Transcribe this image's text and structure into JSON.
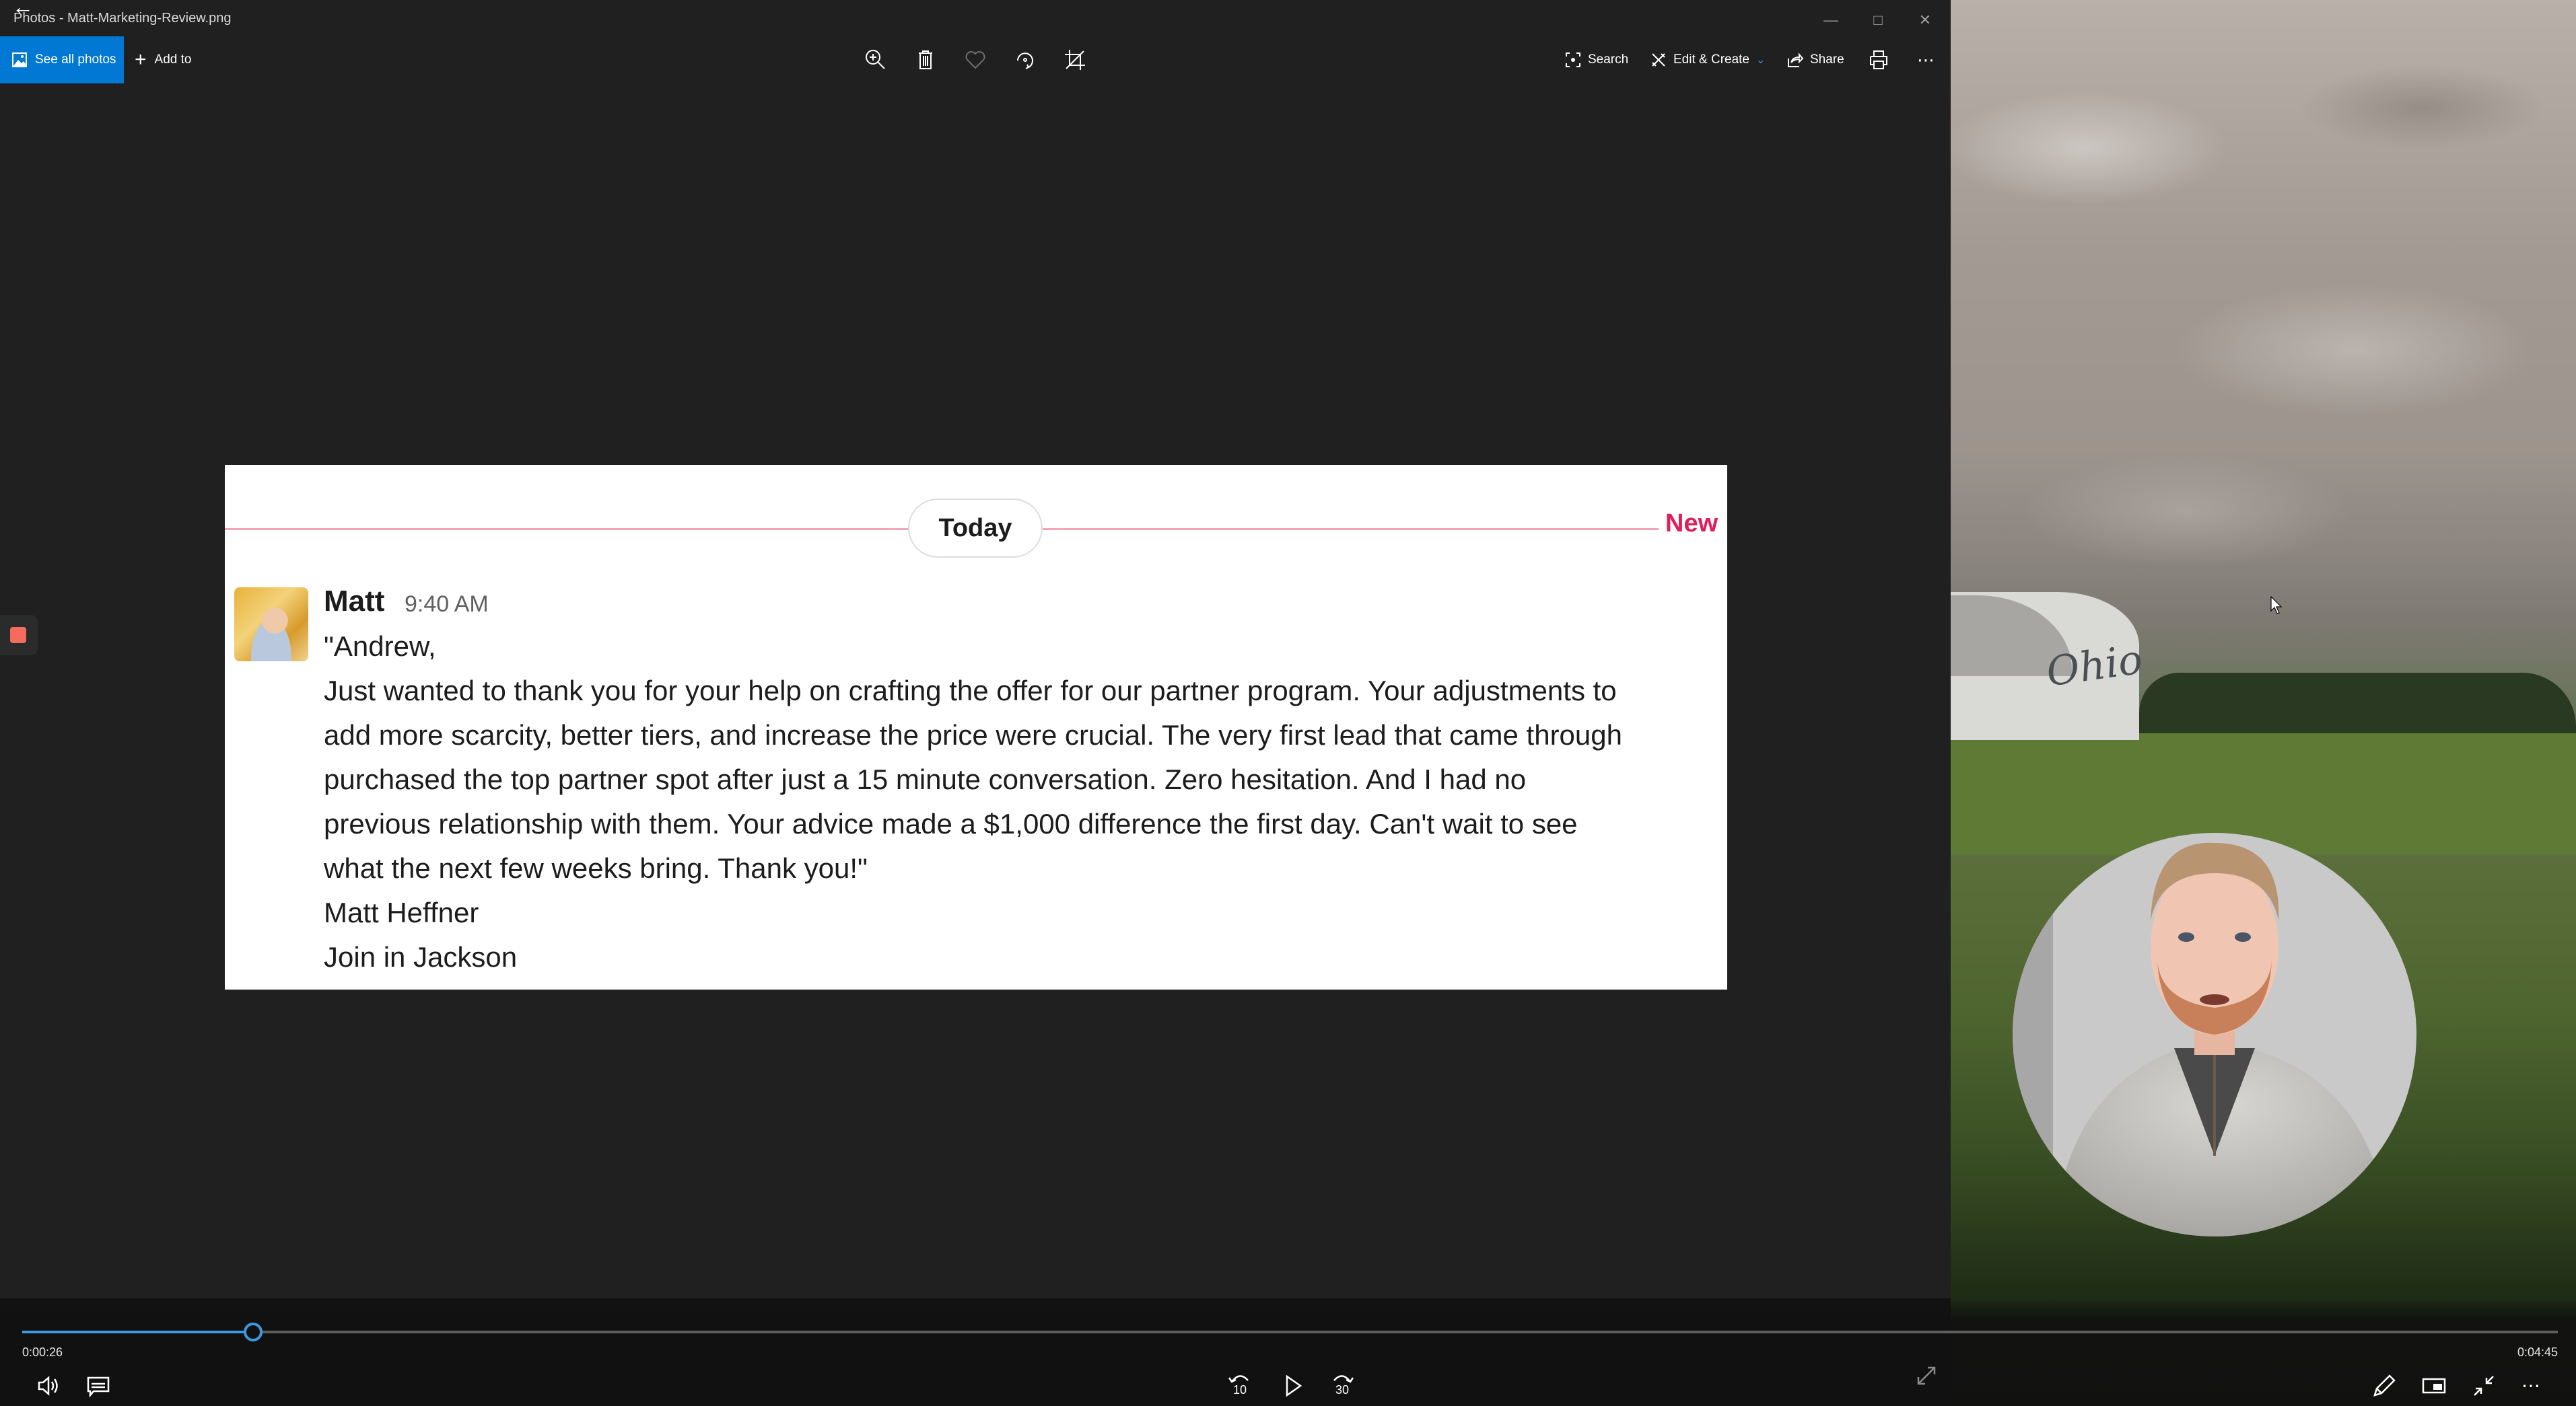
{
  "window": {
    "title": "Photos - Matt-Marketing-Review.png",
    "back_icon": "back-arrow-icon",
    "controls": [
      "minimize",
      "maximize",
      "close"
    ]
  },
  "toolbar": {
    "see_all_photos": "See all photos",
    "add_to": "Add to",
    "center_icons": [
      "zoom-in-icon",
      "delete-icon",
      "favorite-icon",
      "rotate-icon",
      "crop-icon"
    ],
    "search": "Search",
    "edit_create": "Edit & Create",
    "share": "Share",
    "print_icon": "print-icon",
    "more_icon": "more-icon"
  },
  "message": {
    "divider_label": "Today",
    "new_label": "New",
    "sender": "Matt",
    "time": "9:40 AM",
    "lines": [
      "\"Andrew,",
      "Just wanted to thank you for your help on crafting the offer for our partner program. Your adjustments to",
      "add more scarcity, better tiers, and increase the price were crucial. The very first lead that came through",
      "purchased the top partner spot after just a 15 minute conversation. Zero hesitation. And I had no",
      "previous relationship with them. Your advice made a $1,000 difference the first day. Can't wait to see",
      "what the next few weeks bring. Thank you!\"",
      "Matt Heffner",
      "Join in Jackson"
    ],
    "colors": {
      "divider": "#f2a4b8",
      "new": "#e01e5a",
      "text": "#1d1c1d"
    }
  },
  "player": {
    "current_time": "0:00:26",
    "total_time": "0:04:45",
    "progress_fraction": 0.091,
    "accent": "#3d99e0",
    "left_buttons": [
      "volume-icon",
      "subtitles-icon"
    ],
    "center_buttons": {
      "rewind_label": "10",
      "forward_label": "30"
    },
    "right_buttons": [
      "draw-icon",
      "picture-in-picture-icon",
      "exit-fullscreen-icon",
      "more-icon"
    ]
  },
  "overlay": {
    "recording_stop_color": "#f36c5e",
    "webcam": "presenter-webcam"
  }
}
